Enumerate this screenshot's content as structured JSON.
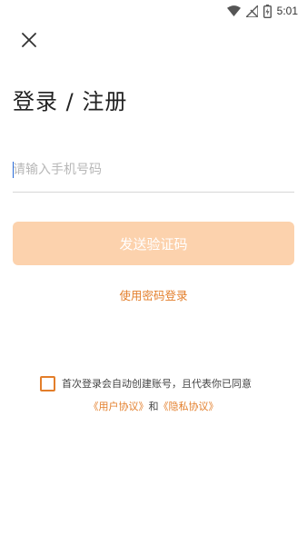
{
  "status_bar": {
    "time": "5:01",
    "icons": [
      "wifi-icon",
      "no-signal-icon",
      "battery-charging-icon"
    ]
  },
  "header": {
    "close_icon": "close-icon",
    "title": "登录 / 注册"
  },
  "form": {
    "phone_placeholder": "请输入手机号码",
    "phone_value": "",
    "send_code_label": "发送验证码",
    "password_login_label": "使用密码登录"
  },
  "agreement": {
    "checked": false,
    "text": "首次登录会自动创建账号，且代表你已同意",
    "user_agreement": "《用户协议》",
    "and": "和",
    "privacy_agreement": "《隐私协议》"
  },
  "colors": {
    "accent": "#e37e2a",
    "button_disabled": "#fcd2ad"
  }
}
